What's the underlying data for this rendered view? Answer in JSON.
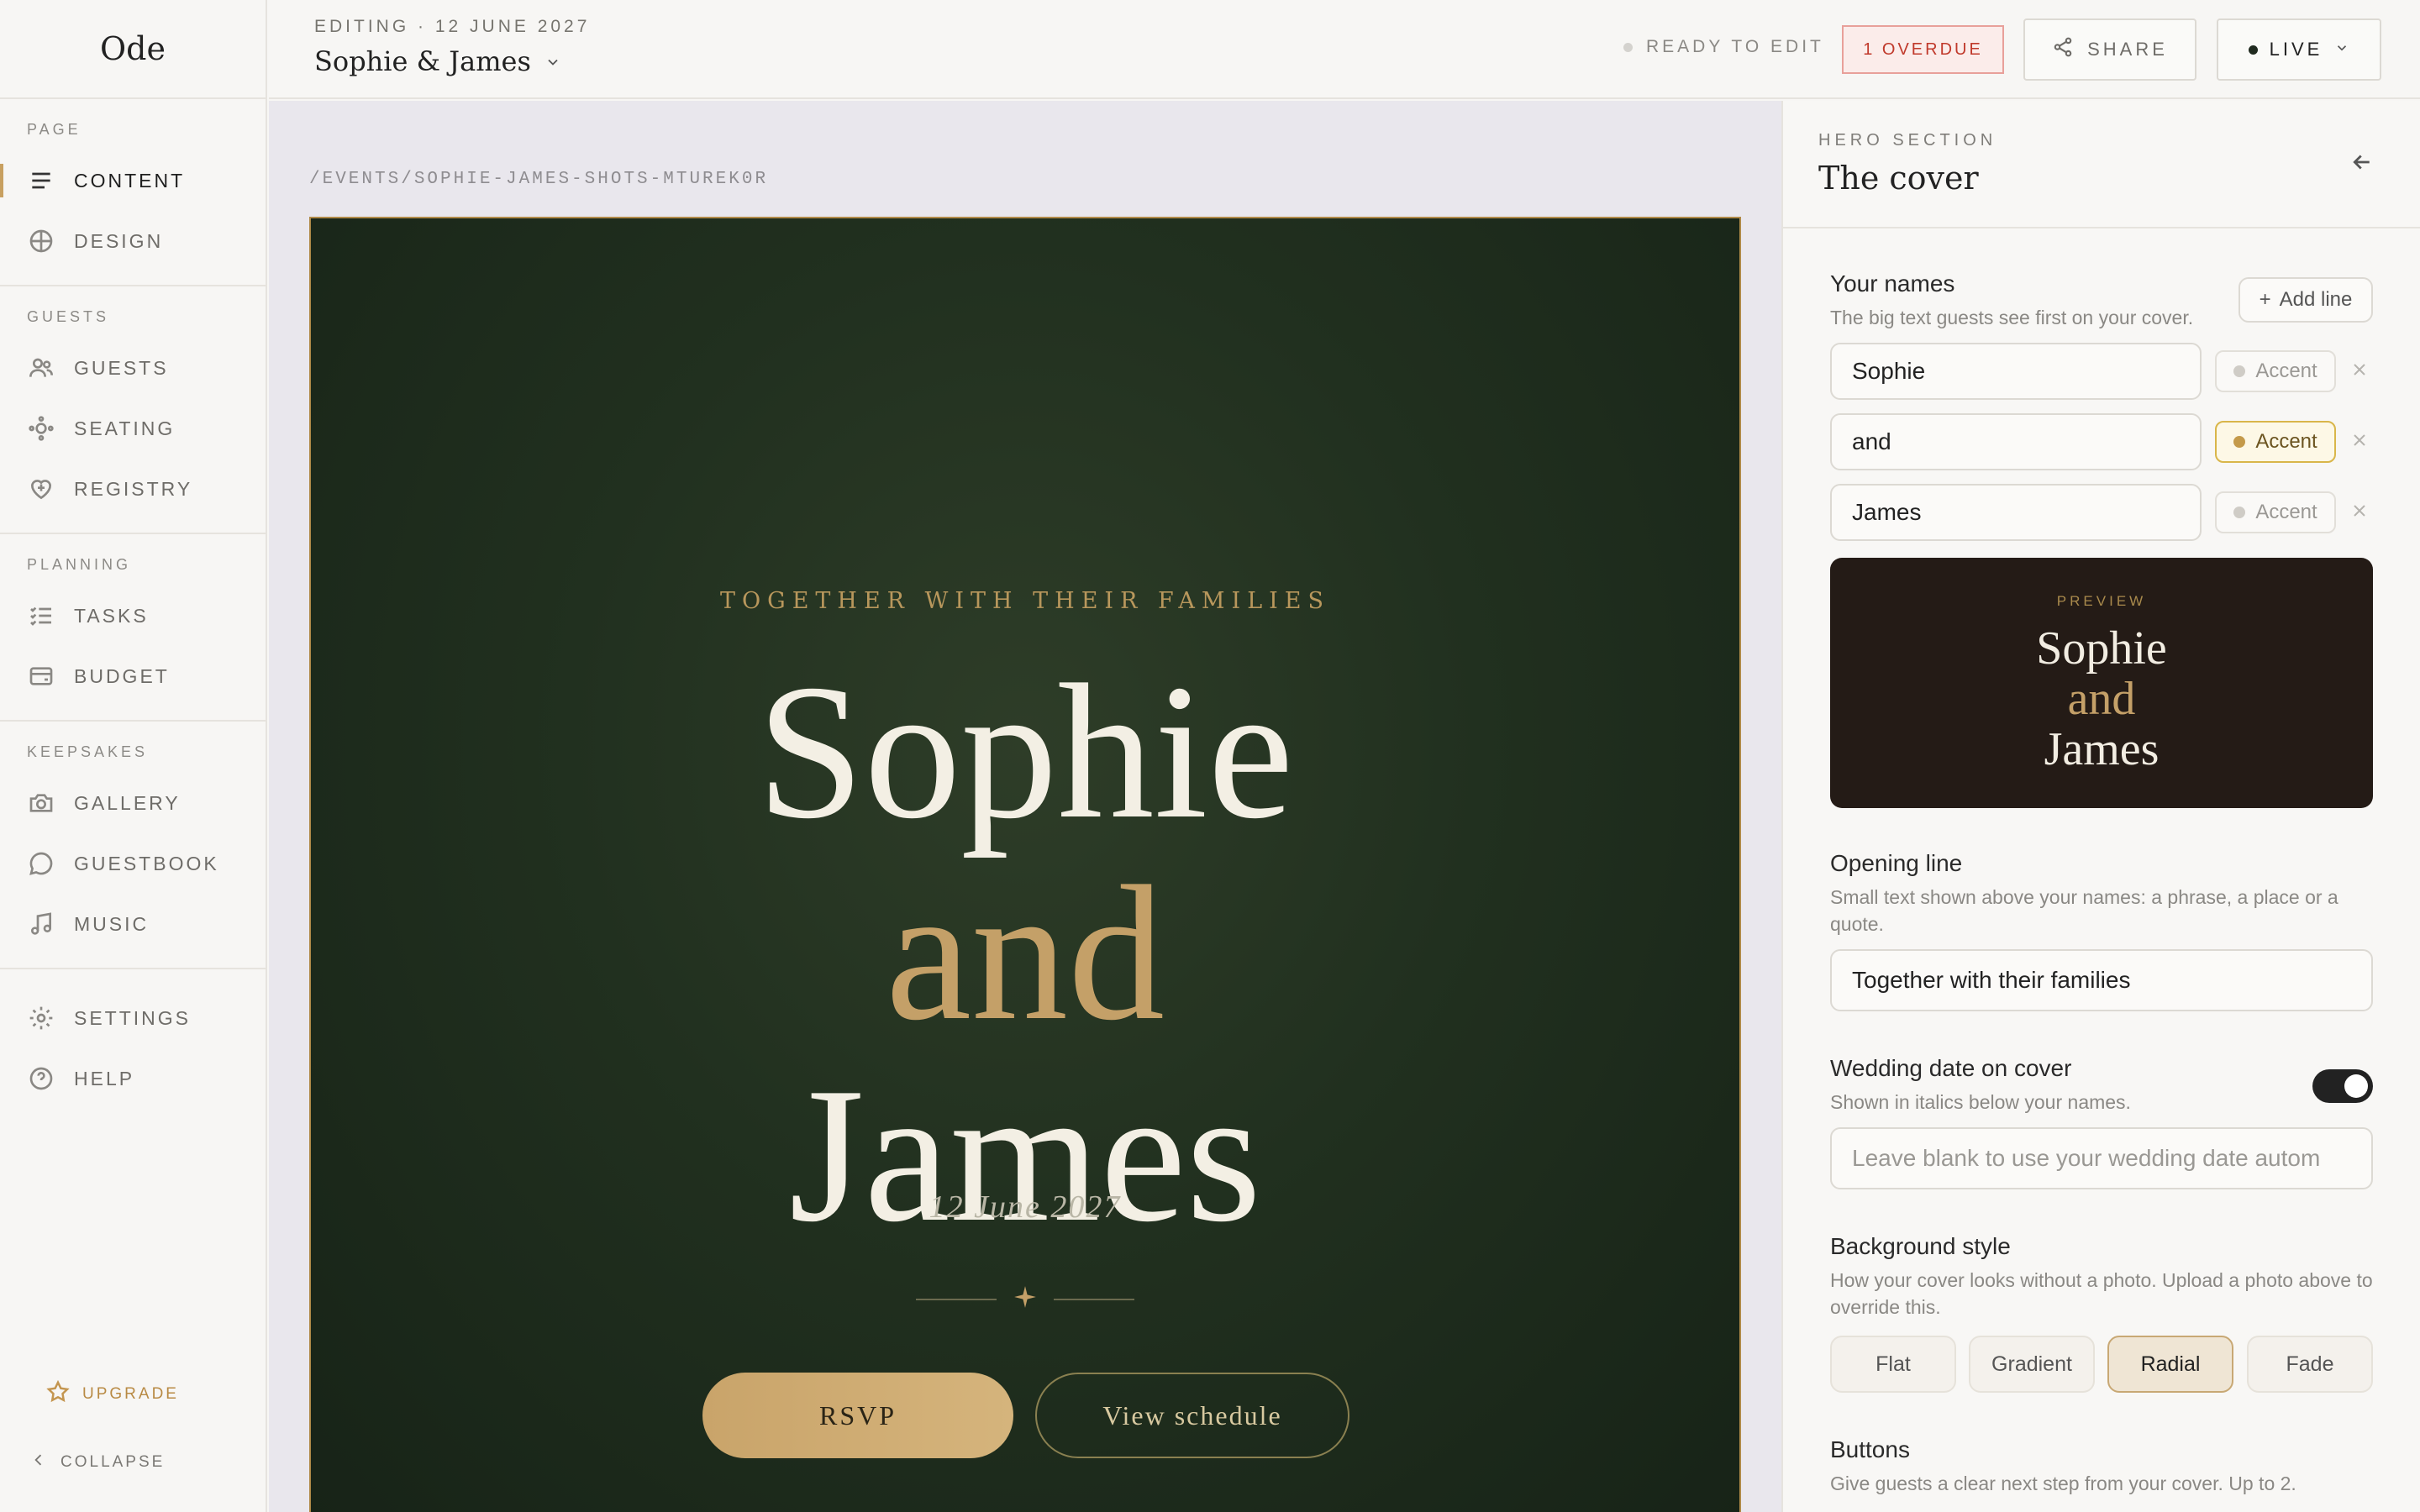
{
  "app": {
    "logo": "Ode"
  },
  "sidebar": {
    "groups": [
      {
        "label": "PAGE",
        "items": [
          {
            "label": "CONTENT",
            "icon": "menu-lines-icon",
            "active": true
          },
          {
            "label": "DESIGN",
            "icon": "globe-icon"
          }
        ]
      },
      {
        "label": "GUESTS",
        "items": [
          {
            "label": "GUESTS",
            "icon": "people-icon"
          },
          {
            "label": "SEATING",
            "icon": "seating-icon"
          },
          {
            "label": "REGISTRY",
            "icon": "heart-icon"
          }
        ]
      },
      {
        "label": "PLANNING",
        "items": [
          {
            "label": "TASKS",
            "icon": "checklist-icon"
          },
          {
            "label": "BUDGET",
            "icon": "wallet-icon"
          }
        ]
      },
      {
        "label": "KEEPSAKES",
        "items": [
          {
            "label": "GALLERY",
            "icon": "camera-icon"
          },
          {
            "label": "GUESTBOOK",
            "icon": "chat-bubble-icon"
          },
          {
            "label": "MUSIC",
            "icon": "music-note-icon"
          }
        ]
      },
      {
        "label": "",
        "items": [
          {
            "label": "SETTINGS",
            "icon": "gear-icon"
          },
          {
            "label": "HELP",
            "icon": "help-circle-icon"
          }
        ]
      }
    ],
    "upgrade": "UPGRADE",
    "collapse": "COLLAPSE"
  },
  "header": {
    "editing": "EDITING · 12 JUNE 2027",
    "event_title": "Sophie & James",
    "status": "READY TO EDIT",
    "overdue": "1 OVERDUE",
    "share": "SHARE",
    "live": "LIVE"
  },
  "canvas": {
    "path": "/EVENTS/SOPHIE-JAMES-SHOTS-MTUREK0R",
    "cover": {
      "opening": "TOGETHER WITH THEIR FAMILIES",
      "names": [
        "Sophie",
        "and",
        "James"
      ],
      "date": "12 June 2027",
      "rsvp": "RSVP",
      "schedule": "View schedule"
    }
  },
  "panel": {
    "section_label": "HERO SECTION",
    "section_title": "The cover",
    "names": {
      "label": "Your names",
      "help": "The big text guests see first on your cover.",
      "add_line": "Add line",
      "lines": [
        {
          "value": "Sophie",
          "accent": "Accent",
          "accent_on": false
        },
        {
          "value": "and",
          "accent": "Accent",
          "accent_on": true
        },
        {
          "value": "James",
          "accent": "Accent",
          "accent_on": false
        }
      ]
    },
    "preview": {
      "label": "PREVIEW",
      "names": [
        "Sophie",
        "and",
        "James"
      ]
    },
    "opening": {
      "label": "Opening line",
      "help": "Small text shown above your names: a phrase, a place or a quote.",
      "value": "Together with their families"
    },
    "wedding_date": {
      "label": "Wedding date on cover",
      "help": "Shown in italics below your names.",
      "enabled": true,
      "placeholder": "Leave blank to use your wedding date autom"
    },
    "background": {
      "label": "Background style",
      "help": "How your cover looks without a photo. Upload a photo above to override this.",
      "options": [
        "Flat",
        "Gradient",
        "Radial",
        "Fade"
      ],
      "selected": "Radial"
    },
    "buttons": {
      "label": "Buttons",
      "help": "Give guests a clear next step from your cover. Up to 2."
    }
  },
  "colors": {
    "accent_gold": "#c4a068",
    "cover_green": "#21301f",
    "preview_bg": "#241b16"
  }
}
